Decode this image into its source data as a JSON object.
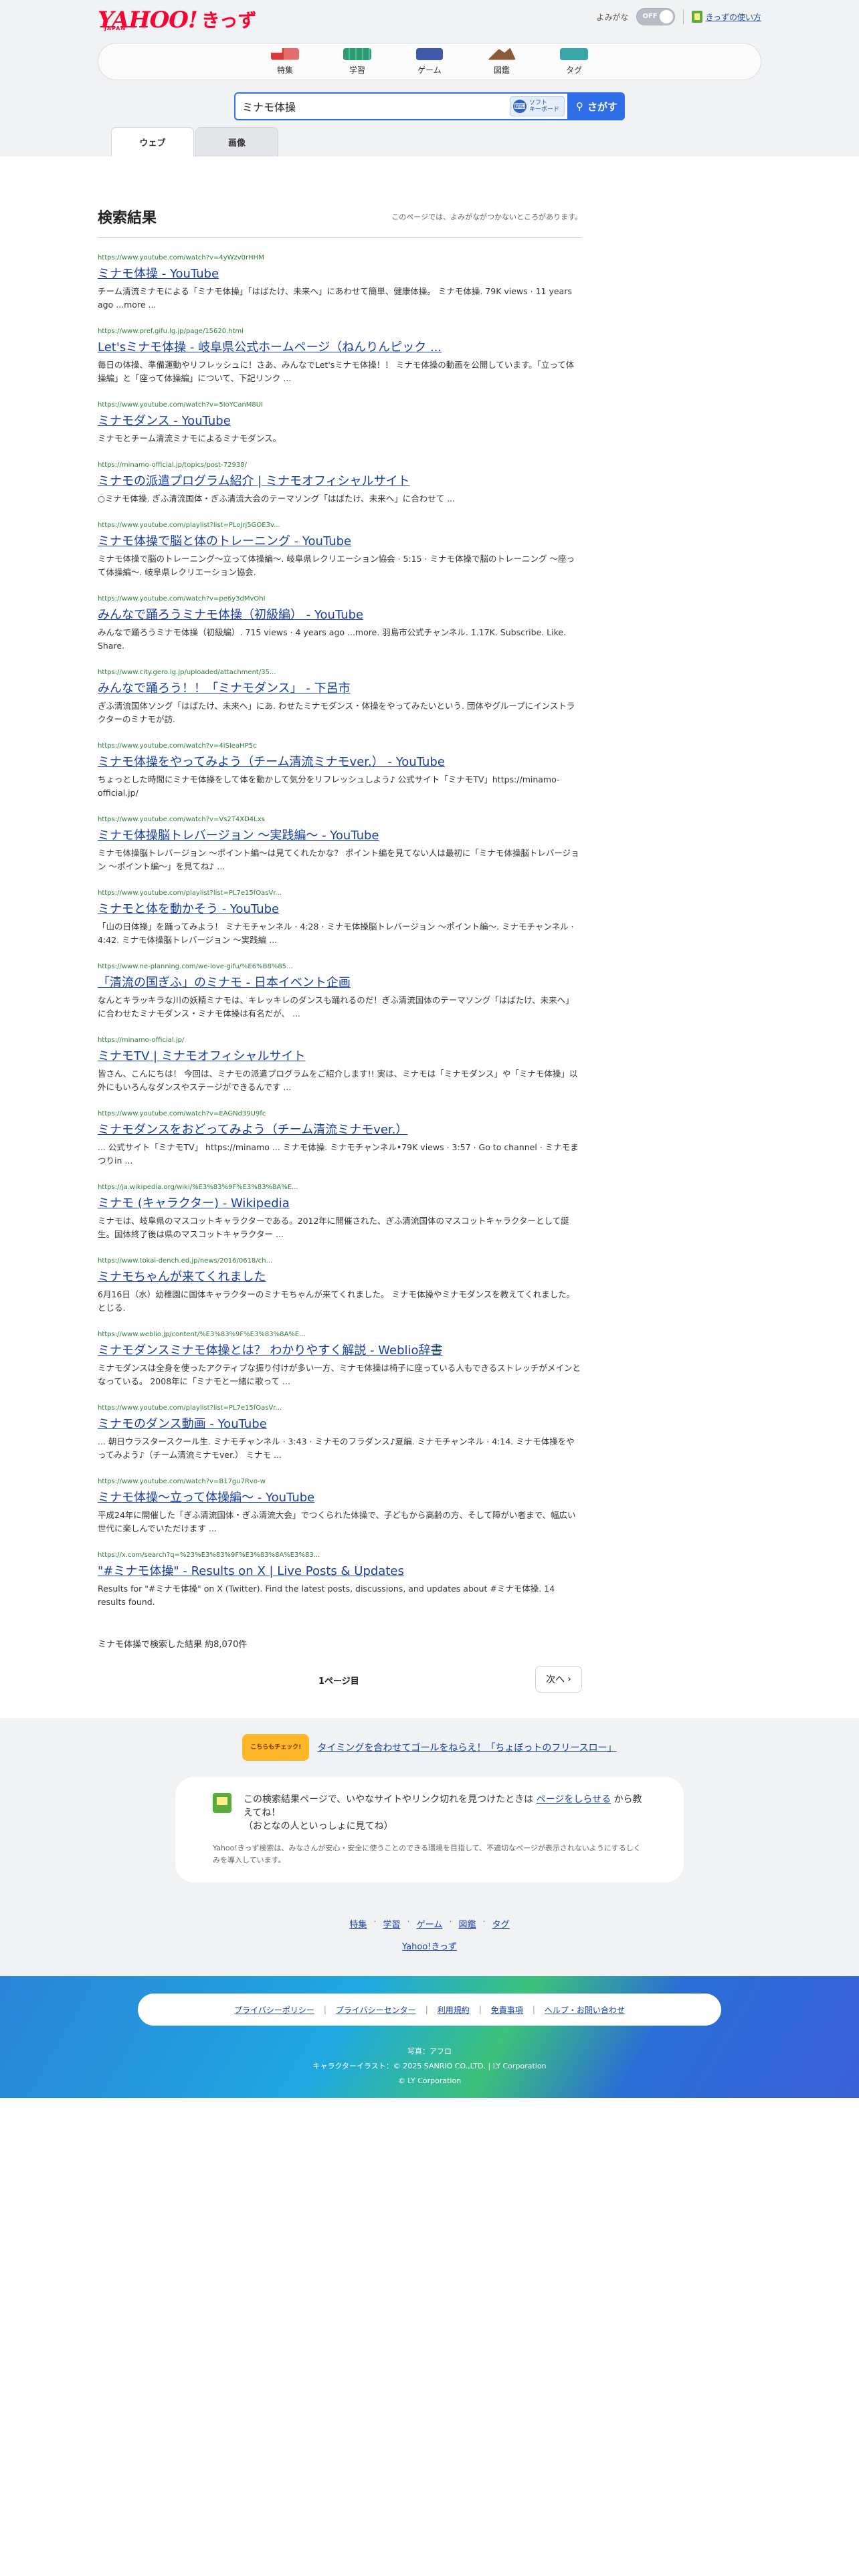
{
  "header": {
    "logo_text": "YAHOO!",
    "logo_sub": "JAPAN",
    "logo_kids": "きっず",
    "yomigana_label": "よみがな",
    "toggle_state": "OFF",
    "howto_label": "きっずの使い方"
  },
  "nav": [
    {
      "label": "特集",
      "icon": "tokushu-icon"
    },
    {
      "label": "学習",
      "icon": "gakushu-icon"
    },
    {
      "label": "ゲーム",
      "icon": "game-icon"
    },
    {
      "label": "図鑑",
      "icon": "zukan-icon"
    },
    {
      "label": "タグ",
      "icon": "tag-icon"
    }
  ],
  "search": {
    "value": "ミナモ体操",
    "keyboard_label_1": "ソフト",
    "keyboard_label_2": "キーボード",
    "button_label": "さがす"
  },
  "tabs": {
    "web": "ウェブ",
    "image": "画像"
  },
  "results_header": {
    "title": "検索結果",
    "note": "このページでは、よみがながつかないところがあります。"
  },
  "results": [
    {
      "url": "https://www.youtube.com/watch?v=4yWzv0rHHM",
      "title": "ミナモ体操 - YouTube",
      "snippet": "チーム清流ミナモによる「ミナモ体操」「はばたけ、未来へ」にあわせて簡単、健康体操。 ミナモ体操. 79K views · 11 years ago ...more ..."
    },
    {
      "url": "https://www.pref.gifu.lg.jp/page/15620.html",
      "title": "Let'sミナモ体操 - 岐阜県公式ホームページ（ねんりんピック ...",
      "snippet": "毎日の体操、準備運動やリフレッシュに！さあ、みんなでLet'sミナモ体操！！ ミナモ体操の動画を公開しています。「立って体操編」と「座って体操編」について、下記リンク ..."
    },
    {
      "url": "https://www.youtube.com/watch?v=5IoYCanM8UI",
      "title": "ミナモダンス - YouTube",
      "snippet": "ミナモとチーム清流ミナモによるミナモダンス。"
    },
    {
      "url": "https://minamo-official.jp/topics/post-72938/",
      "title": "ミナモの派遣プログラム紹介 | ミナモオフィシャルサイト",
      "snippet": "○ミナモ体操. ぎふ清流国体・ぎふ清流大会のテーマソング「はばたけ、未来へ」に合わせて ..."
    },
    {
      "url": "https://www.youtube.com/playlist?list=PLoJrj5GOE3v...",
      "title": "ミナモ体操で脳と体のトレーニング - YouTube",
      "snippet": "ミナモ体操で脳のトレーニング〜立って体操編〜. 岐阜県レクリエーション協会 · 5:15 · ミナモ体操で脳のトレーニング 〜座って体操編〜. 岐阜県レクリエーション協会."
    },
    {
      "url": "https://www.youtube.com/watch?v=pe6y3dMvOhI",
      "title": "みんなで踊ろうミナモ体操（初級編） - YouTube",
      "snippet": "みんなで踊ろうミナモ体操（初級編）. 715 views · 4 years ago ...more. 羽島市公式チャンネル. 1.17K. Subscribe. Like. Share."
    },
    {
      "url": "https://www.city.gero.lg.jp/uploaded/attachment/35...",
      "title": "みんなで踊ろう！！「ミナモダンス」 - 下呂市",
      "snippet": "ぎふ清流国体ソング「はばたけ、未来へ」にあ. わせたミナモダンス・体操をやってみたいという. 団体やグループにインストラクターのミナモが訪."
    },
    {
      "url": "https://www.youtube.com/watch?v=4iSIeaHP5c",
      "title": "ミナモ体操をやってみよう（チーム清流ミナモver.） - YouTube",
      "snippet": "ちょっとした時間にミナモ体操をして体を動かして気分をリフレッシュしよう♪ 公式サイト「ミナモTV」https://minamo-official.jp/"
    },
    {
      "url": "https://www.youtube.com/watch?v=Vs2T4XD4Lxs",
      "title": "ミナモ体操脳トレバージョン 〜実践編〜 - YouTube",
      "snippet": "ミナモ体操脳トレバージョン 〜ポイント編〜は見てくれたかな？ ポイント編を見てない人は最初に「ミナモ体操脳トレバージョン 〜ポイント編〜」を見てね♪ ..."
    },
    {
      "url": "https://www.youtube.com/playlist?list=PL7e15fOasVr...",
      "title": "ミナモと体を動かそう - YouTube",
      "snippet": "「山の日体操」を踊ってみよう！ ミナモチャンネル · 4:28 · ミナモ体操脳トレバージョン 〜ポイント編〜. ミナモチャンネル · 4:42. ミナモ体操脳トレバージョン 〜実践編 ..."
    },
    {
      "url": "https://www.ne-planning.com/we-love-gifu/%E6%B8%85...",
      "title": "「清流の国ぎふ」のミナモ - 日本イベント企画",
      "snippet": "なんとキラッキラな川の妖精ミナモは、キレッキレのダンスも踊れるのだ！ぎふ清流国体のテーマソング「はばたけ、未来へ」に合わせたミナモダンス・ミナモ体操は有名だが、 ..."
    },
    {
      "url": "https://minamo-official.jp/",
      "title": "ミナモTV | ミナモオフィシャルサイト",
      "snippet": "皆さん、こんにちは！ 今回は、ミナモの派遣プログラムをご紹介します!! 実は、ミナモは「ミナモダンス」や「ミナモ体操」以外にもいろんなダンスやステージができるんです ..."
    },
    {
      "url": "https://www.youtube.com/watch?v=EAGNd39U9fc",
      "title": "ミナモダンスをおどってみよう（チーム清流ミナモver.）",
      "snippet": "... 公式サイト「ミナモTV」 https://minamo ... ミナモ体操. ミナモチャンネル•79K views · 3:57 · Go to channel · ミナモまつりin ..."
    },
    {
      "url": "https://ja.wikipedia.org/wiki/%E3%83%9F%E3%83%8A%E...",
      "title": "ミナモ (キャラクター) - Wikipedia",
      "snippet": "ミナモは、岐阜県のマスコットキャラクターである。2012年に開催された、ぎふ清流国体のマスコットキャラクターとして誕生。国体終了後は県のマスコットキャラクター ..."
    },
    {
      "url": "https://www.tokai-dench.ed.jp/news/2016/0618/ch...",
      "title": "ミナモちゃんが来てくれました",
      "snippet": "6月16日（水）幼稚園に国体キャラクターのミナモちゃんが来てくれました。 ミナモ体操やミナモダンスを教えてくれました。 とじる."
    },
    {
      "url": "https://www.weblio.jp/content/%E3%83%9F%E3%83%8A%E...",
      "title": "ミナモダンスミナモ体操とは？ わかりやすく解説 - Weblio辞書",
      "snippet": "ミナモダンスは全身を使ったアクティブな振り付けが多い一方、ミナモ体操は椅子に座っている人もできるストレッチがメインとなっている。 2008年に「ミナモと一緒に歌って ..."
    },
    {
      "url": "https://www.youtube.com/playlist?list=PL7e15fOasVr...",
      "title": "ミナモのダンス動画 - YouTube",
      "snippet": "... 朝日ウラスタースクール生. ミナモチャンネル · 3:43 · ミナモのフラダンス♪夏編. ミナモチャンネル · 4:14. ミナモ体操をやってみよう♪（チーム清流ミナモver.） ミナモ ..."
    },
    {
      "url": "https://www.youtube.com/watch?v=B17gu7Rvo-w",
      "title": "ミナモ体操〜立って体操編〜 - YouTube",
      "snippet": "平成24年に開催した「ぎふ清流国体・ぎふ清流大会」でつくられた体操で、子どもから高齢の方、そして障がい者まで、幅広い世代に楽しんでいただけます ..."
    },
    {
      "url": "https://x.com/search?q=%23%E3%83%9F%E3%83%8A%E3%83...",
      "title": "\"#ミナモ体操\" - Results on X | Live Posts & Updates",
      "snippet": "Results for \"#ミナモ体操\" on X (Twitter). Find the latest posts, discussions, and updates about #ミナモ体操. 14 results found."
    }
  ],
  "result_count": "ミナモ体操で検索した結果 約8,070件",
  "pager": {
    "current": "1ページ目",
    "next": "次へ"
  },
  "promo": {
    "badge": "こちらもチェック!",
    "link": "タイミングを合わせてゴールをねらえ！「ちょぼっトのフリースロー」"
  },
  "report": {
    "line1_before": "この検索結果ページで、いやなサイトやリンク切れを見つけたときは",
    "link": "ページをしらせる",
    "line1_after": "から教えてね！",
    "line2": "（おとなの人といっしょに見てね）",
    "note": "Yahoo!きっず検索は、みなさんが安心・安全に使うことのできる環境を目指して、不適切なページが表示されないようにするしくみを導入しています。"
  },
  "footer_nav": [
    "特集",
    "学習",
    "ゲーム",
    "図鑑",
    "タグ"
  ],
  "footer_brand": "Yahoo!きっず",
  "legal_links": [
    "プライバシーポリシー",
    "プライバシーセンター",
    "利用規約",
    "免責事項",
    "ヘルプ・お問い合わせ"
  ],
  "credits": [
    "写真：アフロ",
    "キャラクターイラスト：© 2025 SANRIO CO.,LTD. | LY Corporation",
    "© LY Corporation"
  ]
}
